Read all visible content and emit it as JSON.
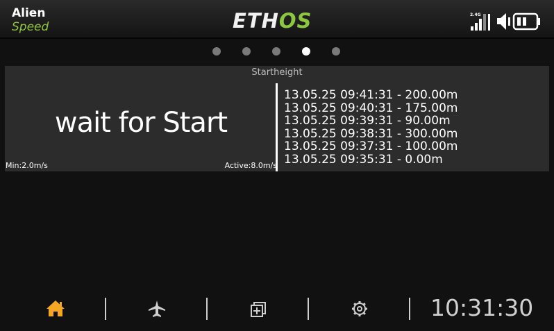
{
  "header": {
    "model_name": "Alien",
    "model_subtitle": "Speed",
    "brand_part1": "ETH",
    "brand_part2": "OS",
    "rssi_label": "2.4G"
  },
  "pager": {
    "count": 5,
    "active_index": 3
  },
  "widget": {
    "title": "Startheight",
    "status_text": "wait for Start",
    "min_label": "Min:2.0m/s",
    "active_label": "Active:8.0m/s",
    "log": [
      "13.05.25 09:41:31 - 200.00m",
      "13.05.25 09:40:31 - 175.00m",
      "13.05.25 09:39:31 - 90.00m",
      "13.05.25 09:38:31 - 300.00m",
      "13.05.25 09:37:31 - 100.00m",
      "13.05.25 09:35:31 - 0.00m"
    ]
  },
  "bottombar": {
    "icons": [
      "home-icon",
      "airplane-icon",
      "widgets-icon",
      "gear-icon"
    ],
    "clock": "10:31:30"
  },
  "colors": {
    "accent_green": "#8dc63f",
    "home_active": "#f5a623",
    "icon_inactive": "#cfcfcf"
  }
}
